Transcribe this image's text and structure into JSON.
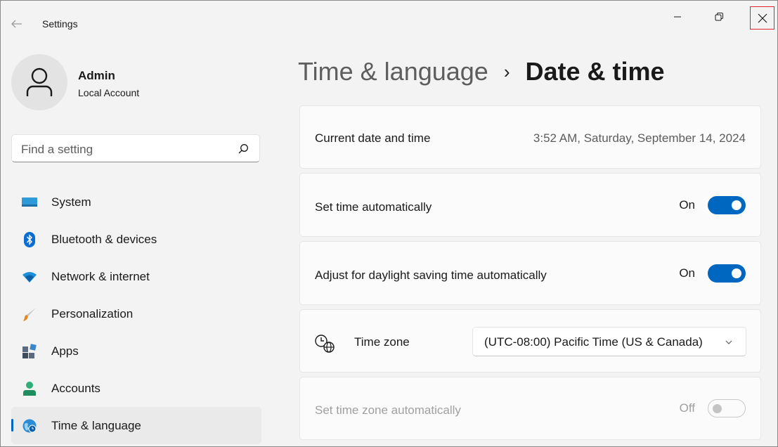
{
  "titlebar": {
    "app_title": "Settings"
  },
  "profile": {
    "name": "Admin",
    "account_type": "Local Account"
  },
  "search": {
    "placeholder": "Find a setting"
  },
  "sidebar": {
    "items": [
      {
        "label": "System",
        "icon": "system-icon"
      },
      {
        "label": "Bluetooth & devices",
        "icon": "bluetooth-icon"
      },
      {
        "label": "Network & internet",
        "icon": "wifi-icon"
      },
      {
        "label": "Personalization",
        "icon": "brush-icon"
      },
      {
        "label": "Apps",
        "icon": "apps-icon"
      },
      {
        "label": "Accounts",
        "icon": "person-icon"
      },
      {
        "label": "Time & language",
        "icon": "globe-clock-icon",
        "active": true
      }
    ]
  },
  "breadcrumb": {
    "parent": "Time & language",
    "separator": "›",
    "current": "Date & time"
  },
  "settings": {
    "current_datetime": {
      "label": "Current date and time",
      "value": "3:52 AM, Saturday, September 14, 2024"
    },
    "set_time_auto": {
      "label": "Set time automatically",
      "state": "On"
    },
    "daylight_saving": {
      "label": "Adjust for daylight saving time automatically",
      "state": "On"
    },
    "time_zone": {
      "label": "Time zone",
      "selected": "(UTC-08:00) Pacific Time (US & Canada)"
    },
    "set_tz_auto": {
      "label": "Set time zone automatically",
      "state": "Off"
    }
  },
  "colors": {
    "accent": "#0067c0",
    "close_highlight": "#e0242e"
  }
}
